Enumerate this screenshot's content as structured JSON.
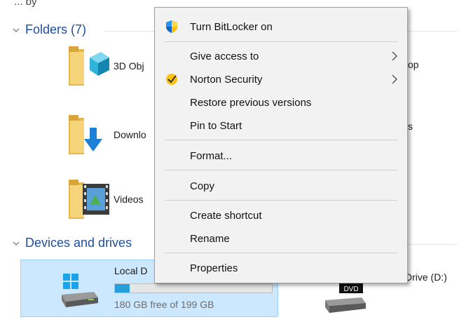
{
  "top_partial_text": "... by",
  "folders_section": {
    "label": "Folders (7)",
    "items": [
      {
        "name": "3D Obj",
        "icon": "3d-objects-folder-icon"
      },
      {
        "name": "Downlo",
        "icon": "downloads-folder-icon"
      },
      {
        "name": "Videos",
        "icon": "videos-folder-icon"
      }
    ],
    "right_partials": [
      "op",
      "s"
    ]
  },
  "devices_section": {
    "label": "Devices and drives",
    "local_drive": {
      "name": "Local D",
      "free_text": "180 GB free of 199 GB",
      "used_fraction": 0.095,
      "icon": "windows-drive-icon"
    },
    "dvd_drive": {
      "name_partial": "Drive (D:)",
      "badge": "DVD",
      "icon": "dvd-drive-icon"
    }
  },
  "context_menu": {
    "items": [
      {
        "id": "bitlocker",
        "label": "Turn BitLocker on",
        "icon": "uac-shield-icon",
        "submenu": false
      },
      {
        "id": "give-access",
        "label": "Give access to",
        "submenu": true
      },
      {
        "id": "norton",
        "label": "Norton Security",
        "icon": "norton-check-icon",
        "submenu": true
      },
      {
        "id": "restore",
        "label": "Restore previous versions",
        "submenu": false
      },
      {
        "id": "pin",
        "label": "Pin to Start",
        "submenu": false
      },
      {
        "id": "format",
        "label": "Format...",
        "submenu": false
      },
      {
        "id": "copy",
        "label": "Copy",
        "submenu": false
      },
      {
        "id": "create-shortcut",
        "label": "Create shortcut",
        "submenu": false
      },
      {
        "id": "rename",
        "label": "Rename",
        "submenu": false
      },
      {
        "id": "properties",
        "label": "Properties",
        "submenu": false
      }
    ]
  },
  "colors": {
    "selection_bg": "#cce8ff",
    "selection_border": "#99d1ff",
    "progress_fill": "#26a0da",
    "section_header": "#1f4e9c",
    "menu_bg": "#f2f2f2"
  }
}
